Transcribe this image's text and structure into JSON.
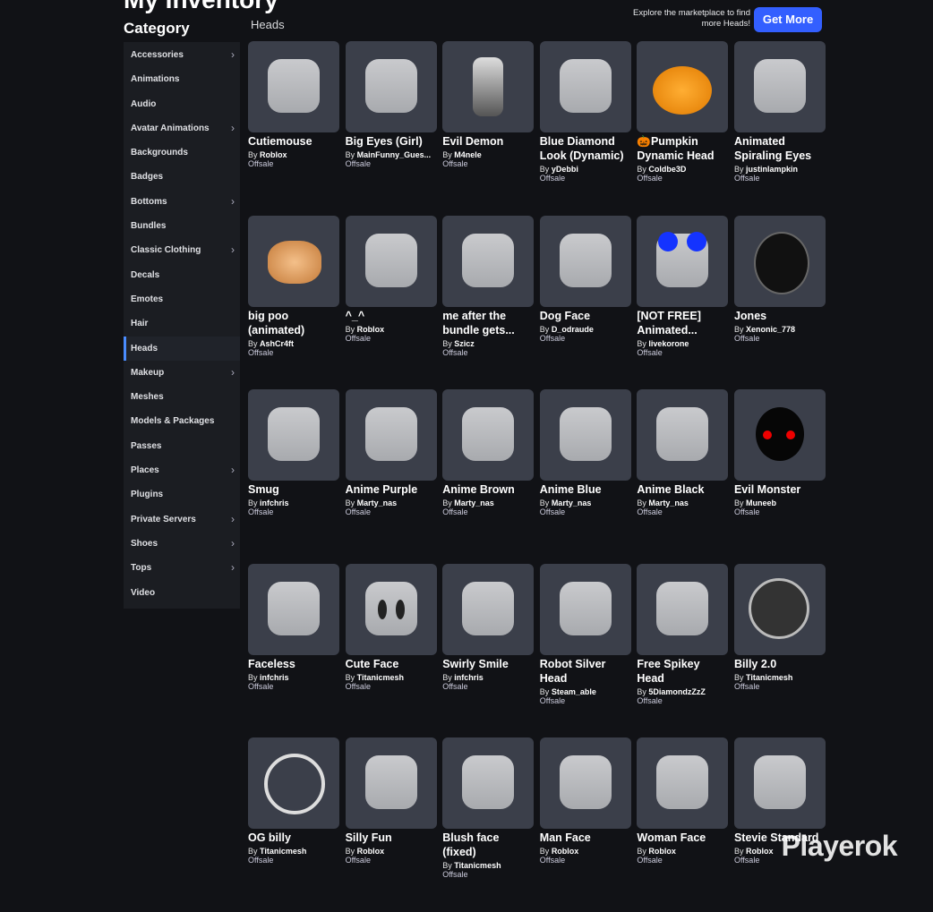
{
  "header": {
    "title": "My Inventory",
    "category_heading": "Category",
    "section_label": "Heads"
  },
  "promo": {
    "text": "Explore the marketplace to find more Heads!",
    "button": "Get More"
  },
  "colors": {
    "background": "#111216",
    "sidebar": "#1b1d22",
    "accent": "#335fff",
    "active_indicator": "#4a8cff",
    "thumb_bg": "#3b3f4a"
  },
  "sidebar": {
    "items": [
      {
        "label": "Accessories",
        "chevron": true
      },
      {
        "label": "Animations",
        "chevron": false
      },
      {
        "label": "Audio",
        "chevron": false
      },
      {
        "label": "Avatar Animations",
        "chevron": true
      },
      {
        "label": "Backgrounds",
        "chevron": false
      },
      {
        "label": "Badges",
        "chevron": false
      },
      {
        "label": "Bottoms",
        "chevron": true
      },
      {
        "label": "Bundles",
        "chevron": false
      },
      {
        "label": "Classic Clothing",
        "chevron": true
      },
      {
        "label": "Decals",
        "chevron": false
      },
      {
        "label": "Emotes",
        "chevron": false
      },
      {
        "label": "Hair",
        "chevron": false
      },
      {
        "label": "Heads",
        "chevron": false,
        "active": true
      },
      {
        "label": "Makeup",
        "chevron": true
      },
      {
        "label": "Meshes",
        "chevron": false
      },
      {
        "label": "Models & Packages",
        "chevron": false
      },
      {
        "label": "Passes",
        "chevron": false
      },
      {
        "label": "Places",
        "chevron": true
      },
      {
        "label": "Plugins",
        "chevron": false
      },
      {
        "label": "Private Servers",
        "chevron": true
      },
      {
        "label": "Shoes",
        "chevron": true
      },
      {
        "label": "Tops",
        "chevron": true
      },
      {
        "label": "Video",
        "chevron": false
      }
    ]
  },
  "items": [
    {
      "name": "Cutiemouse",
      "creator": "Roblox",
      "status": "Offsale"
    },
    {
      "name": "Big Eyes (Girl)",
      "creator": "MainFunny_Gues...",
      "status": "Offsale"
    },
    {
      "name": "Evil Demon",
      "creator": "M4nele",
      "status": "Offsale"
    },
    {
      "name": "Blue Diamond Look (Dynamic)",
      "creator": "yDebbi",
      "status": "Offsale"
    },
    {
      "name": "🎃Pumpkin Dynamic Head",
      "creator": "Coldbe3D",
      "status": "Offsale"
    },
    {
      "name": "Animated Spiraling Eyes",
      "creator": "justinlampkin",
      "status": "Offsale"
    },
    {
      "name": "big poo (animated)",
      "creator": "AshCr4ft",
      "status": "Offsale"
    },
    {
      "name": "^_^",
      "creator": "Roblox",
      "status": "Offsale"
    },
    {
      "name": "me after the bundle gets...",
      "creator": "Szicz",
      "status": "Offsale"
    },
    {
      "name": "Dog Face",
      "creator": "D_odraude",
      "status": "Offsale"
    },
    {
      "name": "[NOT FREE] Animated...",
      "creator": "livekorone",
      "status": "Offsale"
    },
    {
      "name": "Jones",
      "creator": "Xenonic_778",
      "status": "Offsale"
    },
    {
      "name": "Smug",
      "creator": "infchris",
      "status": "Offsale"
    },
    {
      "name": "Anime Purple",
      "creator": "Marty_nas",
      "status": "Offsale"
    },
    {
      "name": "Anime Brown",
      "creator": "Marty_nas",
      "status": "Offsale"
    },
    {
      "name": "Anime Blue",
      "creator": "Marty_nas",
      "status": "Offsale"
    },
    {
      "name": "Anime Black",
      "creator": "Marty_nas",
      "status": "Offsale"
    },
    {
      "name": "Evil Monster",
      "creator": "Muneeb",
      "status": "Offsale"
    },
    {
      "name": "Faceless",
      "creator": "infchris",
      "status": "Offsale"
    },
    {
      "name": "Cute Face",
      "creator": "Titanicmesh",
      "status": "Offsale"
    },
    {
      "name": "Swirly Smile",
      "creator": "infchris",
      "status": "Offsale"
    },
    {
      "name": "Robot Silver Head",
      "creator": "Steam_able",
      "status": "Offsale"
    },
    {
      "name": "Free Spikey Head",
      "creator": "5DiamondzZzZ",
      "status": "Offsale"
    },
    {
      "name": "Billy 2.0",
      "creator": "Titanicmesh",
      "status": "Offsale"
    },
    {
      "name": "OG billy",
      "creator": "Titanicmesh",
      "status": "Offsale"
    },
    {
      "name": "Silly Fun",
      "creator": "Roblox",
      "status": "Offsale"
    },
    {
      "name": "Blush face (fixed)",
      "creator": "Titanicmesh",
      "status": "Offsale"
    },
    {
      "name": "Man Face",
      "creator": "Roblox",
      "status": "Offsale"
    },
    {
      "name": "Woman Face",
      "creator": "Roblox",
      "status": "Offsale"
    },
    {
      "name": "Stevie Standard",
      "creator": "Roblox",
      "status": "Offsale"
    }
  ],
  "by_prefix": "By",
  "watermark": "Playerok"
}
